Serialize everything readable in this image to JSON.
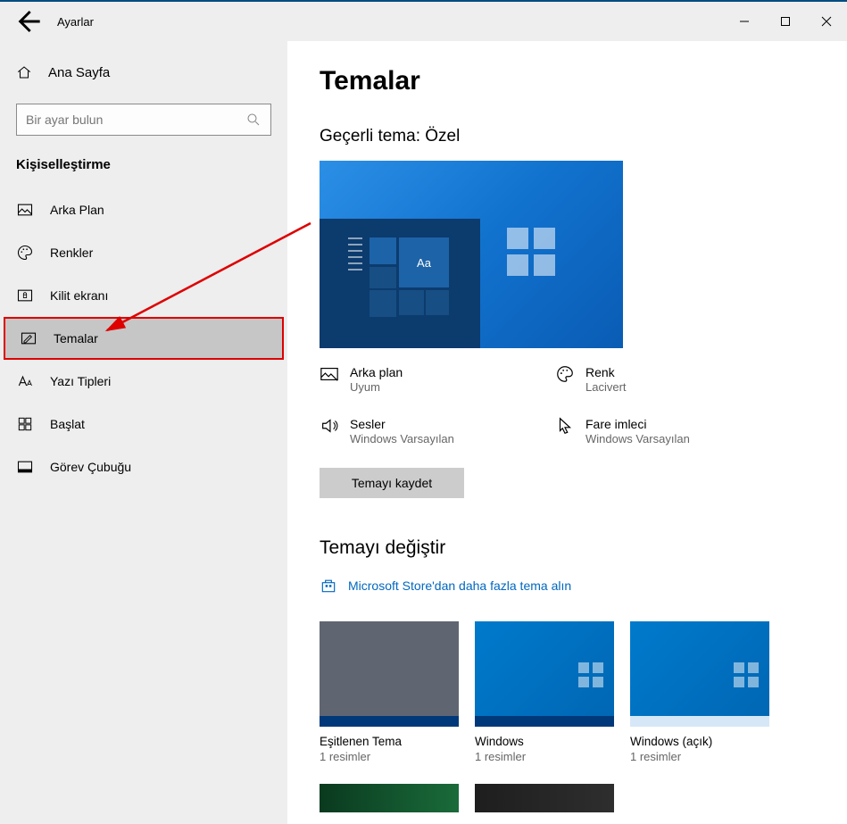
{
  "titlebar": {
    "title": "Ayarlar"
  },
  "sidebar": {
    "home": "Ana Sayfa",
    "search_placeholder": "Bir ayar bulun",
    "section": "Kişiselleştirme",
    "items": [
      {
        "label": "Arka Plan"
      },
      {
        "label": "Renkler"
      },
      {
        "label": "Kilit ekranı"
      },
      {
        "label": "Temalar"
      },
      {
        "label": "Yazı Tipleri"
      },
      {
        "label": "Başlat"
      },
      {
        "label": "Görev Çubuğu"
      }
    ]
  },
  "main": {
    "heading": "Temalar",
    "current_theme_label": "Geçerli tema: Özel",
    "props": {
      "background": {
        "label": "Arka plan",
        "value": "Uyum"
      },
      "color": {
        "label": "Renk",
        "value": "Lacivert"
      },
      "sounds": {
        "label": "Sesler",
        "value": "Windows Varsayılan"
      },
      "cursor": {
        "label": "Fare imleci",
        "value": "Windows Varsayılan"
      }
    },
    "save_button": "Temayı kaydet",
    "change_heading": "Temayı değiştir",
    "store_link": "Microsoft Store'dan daha fazla tema alın",
    "themes": [
      {
        "name": "Eşitlenen Tema",
        "count": "1 resimler"
      },
      {
        "name": "Windows",
        "count": "1 resimler"
      },
      {
        "name": "Windows (açık)",
        "count": "1 resimler"
      }
    ],
    "preview_tile_text": "Aa"
  }
}
